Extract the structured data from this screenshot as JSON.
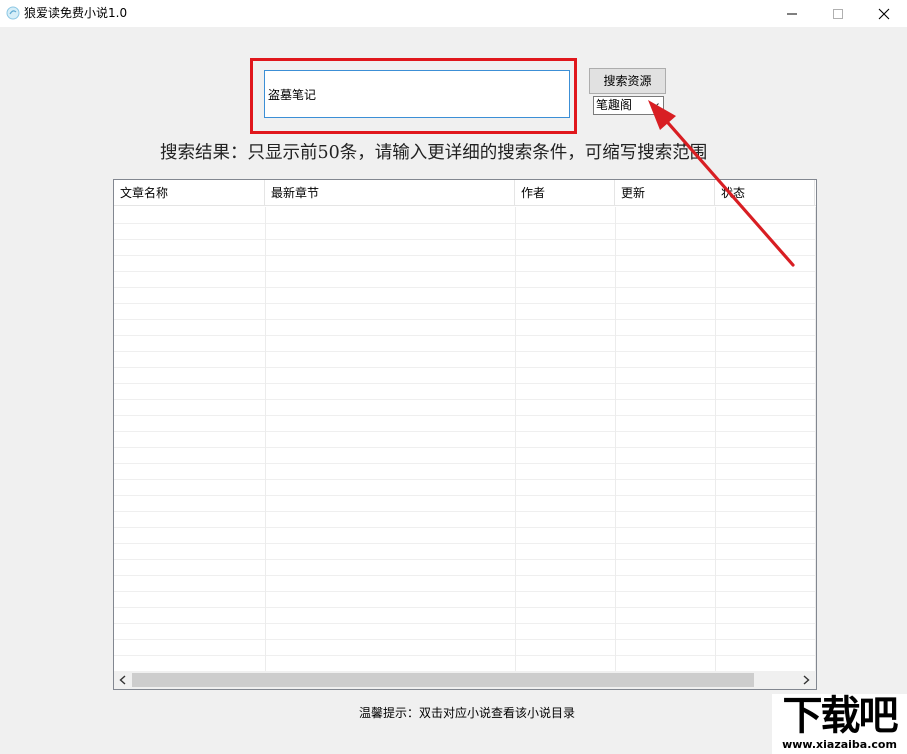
{
  "window": {
    "title": "狼爱读免费小说1.0",
    "icon": "app-logo-icon"
  },
  "search": {
    "value": "盗墓笔记",
    "button_label": "搜索资源",
    "source_selected": "笔趣阁"
  },
  "result_hint": "搜索结果：只显示前50条，请输入更详细的搜索条件，可缩写搜索范围",
  "table": {
    "columns": [
      "文章名称",
      "最新章节",
      "作者",
      "更新",
      "状态"
    ],
    "rows": []
  },
  "footer_tip": "温馨提示：双击对应小说查看该小说目录",
  "watermark": {
    "logo_text": "下载吧",
    "site": "www.xiazaiba.com"
  },
  "colors": {
    "highlight_frame": "#e0171c",
    "arrow": "#d81e23",
    "input_focus": "#3c8fd6"
  }
}
